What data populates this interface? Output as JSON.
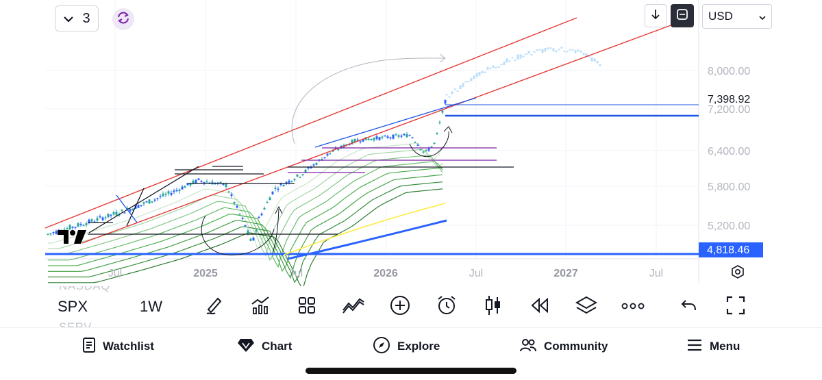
{
  "header": {
    "layers_count": "3",
    "currency": "USD"
  },
  "chart": {
    "price_axis": {
      "ticks": [
        "8,000.00",
        "7,200.00",
        "6,400.00",
        "5,800.00",
        "5,200.00"
      ],
      "last_price": "7,398.92",
      "marked_price": "4,818.46"
    },
    "time_axis": [
      "Jul",
      "2025",
      "Jul",
      "2026",
      "Jul",
      "2027",
      "Jul"
    ]
  },
  "chart_data": {
    "type": "candlestick",
    "symbol": "SPX",
    "timeframe": "1W",
    "y_ticks": [
      5200,
      5800,
      6400,
      7200,
      8000
    ],
    "x_ticks": [
      "Jul",
      "2025",
      "Jul",
      "2026",
      "Jul",
      "2027",
      "Jul"
    ],
    "last_price": 7398.92,
    "horizontal_line_price": 4818.46,
    "colors": {
      "up": "#26a69a",
      "down": "#2962ff",
      "channel": "#e53935",
      "hline": "#2962ff",
      "projection": "#bbdefb"
    }
  },
  "toolbar": {
    "ghost_above": "NASDAQ",
    "symbol": "SPX",
    "ghost_below": "SERV",
    "timeframe": "1W",
    "icons": [
      "draw-icon",
      "indicators-icon",
      "layouts-icon",
      "compare-icon",
      "add-icon",
      "alert-icon",
      "candles-icon",
      "replay-icon",
      "layers-icon",
      "more-icon",
      "undo-icon",
      "fullscreen-icon"
    ]
  },
  "nav": {
    "watchlist": "Watchlist",
    "chart": "Chart",
    "explore": "Explore",
    "community": "Community",
    "menu": "Menu"
  }
}
